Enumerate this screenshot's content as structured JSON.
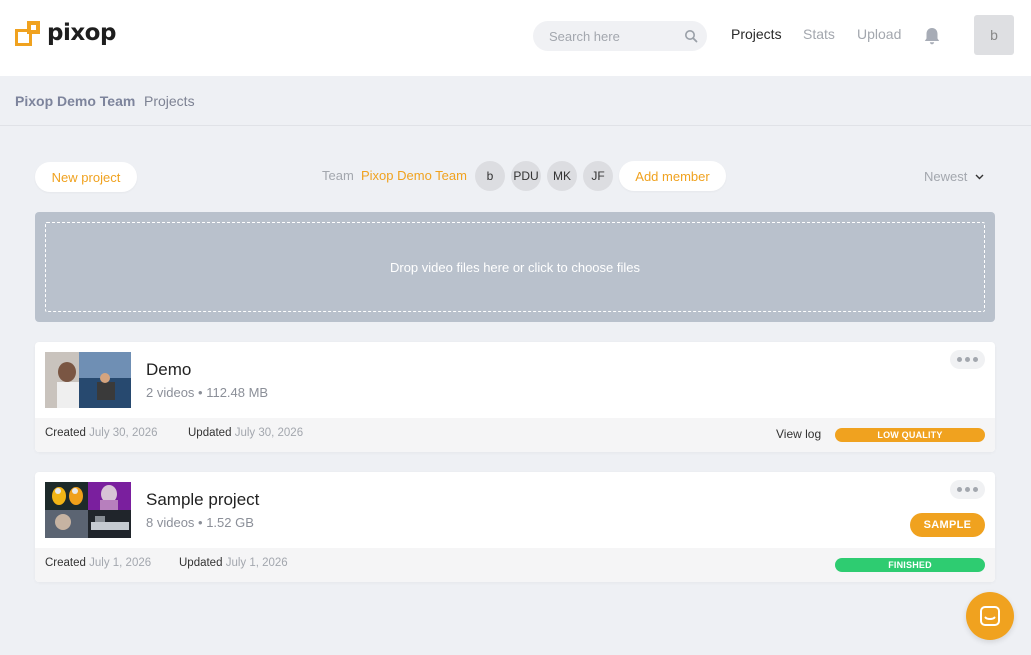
{
  "header": {
    "logo_text": "pixop",
    "search_placeholder": "Search here",
    "nav": [
      {
        "label": "Projects"
      },
      {
        "label": "Stats"
      },
      {
        "label": "Upload"
      }
    ],
    "avatar_initial": "b"
  },
  "breadcrumb": {
    "team": "Pixop Demo Team",
    "current": "Projects"
  },
  "toolbar": {
    "new_project_label": "New project",
    "team_label": "Team",
    "team_name": "Pixop Demo Team",
    "members": [
      "b",
      "PDU",
      "MK",
      "JF"
    ],
    "add_member_label": "Add member",
    "sort_label": "Newest"
  },
  "dropzone": {
    "text": "Drop video files here or click to choose files"
  },
  "projects": [
    {
      "title": "Demo",
      "meta": "2 videos • 112.48 MB",
      "created_label": "Created",
      "created_date": "July 30, 2026",
      "updated_label": "Updated",
      "updated_date": "July 30, 2026",
      "view_log_label": "View log",
      "status": "LOW QUALITY",
      "status_color": "#f0a21f"
    },
    {
      "title": "Sample project",
      "meta": "8 videos • 1.52 GB",
      "badge": "SAMPLE",
      "created_label": "Created",
      "created_date": "July 1, 2026",
      "updated_label": "Updated",
      "updated_date": "July 1, 2026",
      "status": "FINISHED",
      "status_color": "#2ecc71"
    }
  ],
  "colors": {
    "accent": "#f0a21f",
    "success": "#2ecc71",
    "dropzone": "#b9c1cc"
  },
  "icons": {
    "logo": "pixop-logo-icon",
    "search": "search-icon",
    "notifications": "bell-icon",
    "sort": "chevron-down-icon",
    "more": "more-dots-icon",
    "chat": "chat-icon"
  }
}
